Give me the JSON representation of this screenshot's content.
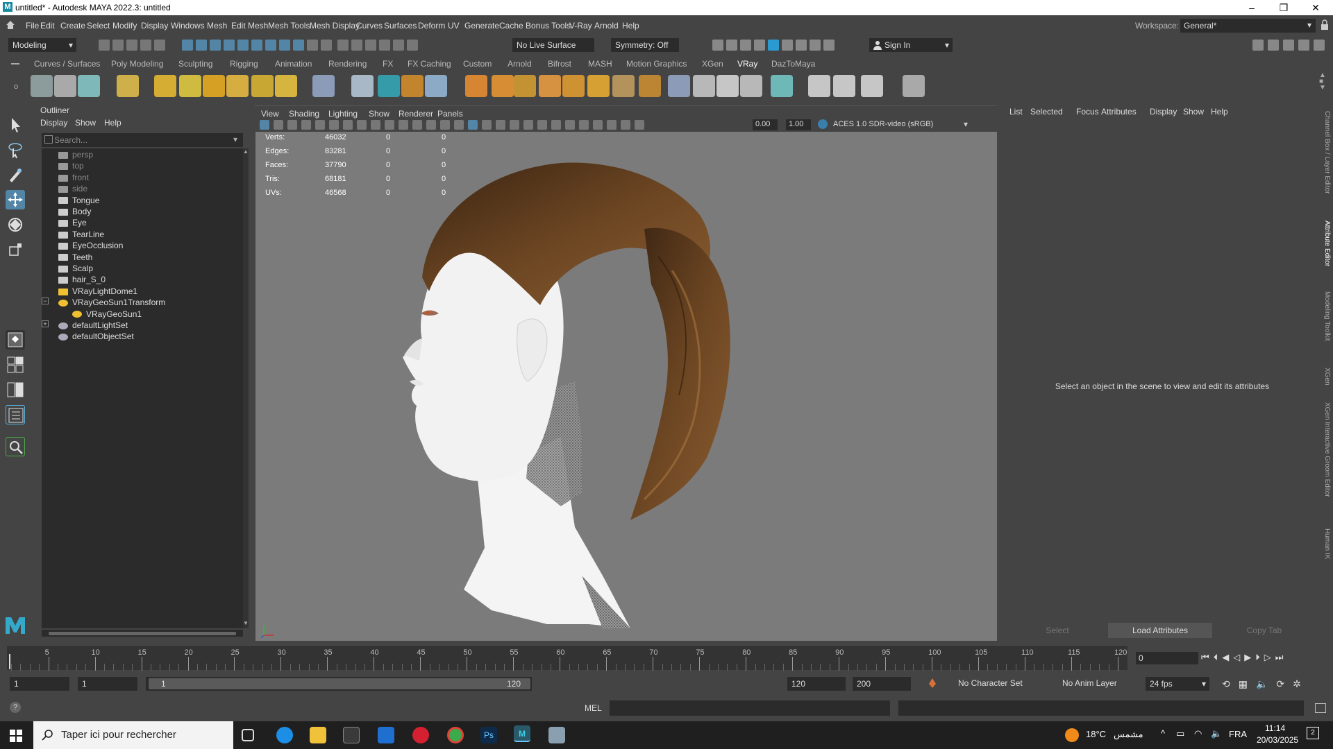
{
  "window": {
    "title": "untitled* - Autodesk MAYA 2022.3: untitled",
    "minimize": "–",
    "maximize": "❐",
    "close": "✕"
  },
  "menubar": [
    "File",
    "Edit",
    "Create",
    "Select",
    "Modify",
    "Display",
    "Windows",
    "Mesh",
    "Edit Mesh",
    "Mesh Tools",
    "Mesh Display",
    "Curves",
    "Surfaces",
    "Deform",
    "UV",
    "Generate",
    "Cache",
    "Bonus Tools",
    "V-Ray",
    "Arnold",
    "Help"
  ],
  "workspace": {
    "label": "Workspace:",
    "value": "General*"
  },
  "statusline": {
    "mode": "Modeling",
    "live_surface": "No Live Surface",
    "symmetry": "Symmetry: Off",
    "sign_in": "Sign In"
  },
  "shelf_tabs": [
    "Curves / Surfaces",
    "Poly Modeling",
    "Sculpting",
    "Rigging",
    "Animation",
    "Rendering",
    "FX",
    "FX Caching",
    "Custom",
    "Arnold",
    "Bifrost",
    "MASH",
    "Motion Graphics",
    "XGen",
    "VRay",
    "DazToMaya"
  ],
  "shelf_active": "VRay",
  "outliner": {
    "title": "Outliner",
    "menu": [
      "Display",
      "Show",
      "Help"
    ],
    "search_placeholder": "Search...",
    "items": [
      {
        "label": "persp",
        "dim": true,
        "kind": "camera",
        "indent": 0
      },
      {
        "label": "top",
        "dim": true,
        "kind": "camera",
        "indent": 0
      },
      {
        "label": "front",
        "dim": true,
        "kind": "camera",
        "indent": 0
      },
      {
        "label": "side",
        "dim": true,
        "kind": "camera",
        "indent": 0
      },
      {
        "label": "Tongue",
        "kind": "mesh",
        "indent": 0
      },
      {
        "label": "Body",
        "kind": "mesh",
        "indent": 0
      },
      {
        "label": "Eye",
        "kind": "mesh",
        "indent": 0
      },
      {
        "label": "TearLine",
        "kind": "mesh",
        "indent": 0
      },
      {
        "label": "EyeOcclusion",
        "kind": "mesh",
        "indent": 0
      },
      {
        "label": "Teeth",
        "kind": "mesh",
        "indent": 0
      },
      {
        "label": "Scalp",
        "kind": "mesh",
        "indent": 0
      },
      {
        "label": "hair_S_0",
        "kind": "mesh",
        "indent": 0
      },
      {
        "label": "VRayLightDome1",
        "kind": "dome",
        "indent": 0
      },
      {
        "label": "VRayGeoSun1Transform",
        "kind": "sun",
        "indent": 0,
        "expander": "−"
      },
      {
        "label": "VRayGeoSun1",
        "kind": "sun",
        "indent": 1
      },
      {
        "label": "defaultLightSet",
        "kind": "set",
        "indent": 0,
        "expander": "+"
      },
      {
        "label": "defaultObjectSet",
        "kind": "set",
        "indent": 0
      }
    ]
  },
  "viewport": {
    "menus": [
      "View",
      "Shading",
      "Lighting",
      "Show",
      "Renderer",
      "Panels"
    ],
    "exposure": "0.00",
    "gamma": "1.00",
    "color_space": "ACES 1.0 SDR-video (sRGB)",
    "hud": [
      {
        "label": "Verts:",
        "a": "46032",
        "b": "0",
        "c": "0"
      },
      {
        "label": "Edges:",
        "a": "83281",
        "b": "0",
        "c": "0"
      },
      {
        "label": "Faces:",
        "a": "37790",
        "b": "0",
        "c": "0"
      },
      {
        "label": "Tris:",
        "a": "68181",
        "b": "0",
        "c": "0"
      },
      {
        "label": "UVs:",
        "a": "46568",
        "b": "0",
        "c": "0"
      }
    ]
  },
  "attribute_editor": {
    "menu": [
      "List",
      "Selected",
      "Focus",
      "Attributes",
      "Display",
      "Show",
      "Help"
    ],
    "message": "Select an object in the scene to view and edit its attributes",
    "buttons": [
      "Select",
      "Load Attributes",
      "Copy Tab"
    ]
  },
  "side_tabs": [
    "Channel Box / Layer Editor",
    "Attribute Editor",
    "Modeling Toolkit",
    "XGen",
    "XGen Interactive Groom Editor",
    "Human IK"
  ],
  "timeline": {
    "ticks": [
      5,
      10,
      15,
      20,
      25,
      30,
      35,
      40,
      45,
      50,
      55,
      60,
      65,
      70,
      75,
      80,
      85,
      90,
      95,
      100,
      105,
      110,
      115,
      120
    ],
    "current_frame": "0"
  },
  "range": {
    "start": "1",
    "playback_start": "1",
    "slider_start": "1",
    "slider_end": "120",
    "playback_end": "120",
    "end": "200",
    "character_set": "No Character Set",
    "anim_layer": "No Anim Layer",
    "fps": "24 fps"
  },
  "cmdline": {
    "label": "MEL"
  },
  "taskbar": {
    "search": "Taper ici pour rechercher",
    "weather": "18°C",
    "weather_text": "مشمس",
    "lang": "FRA",
    "time": "11:14",
    "date": "20/03/2025",
    "notif": "2"
  },
  "colors": {
    "viewport_bg": "#7b7b7b",
    "accent": "#5285a6",
    "hair": "#5a3a1c"
  }
}
